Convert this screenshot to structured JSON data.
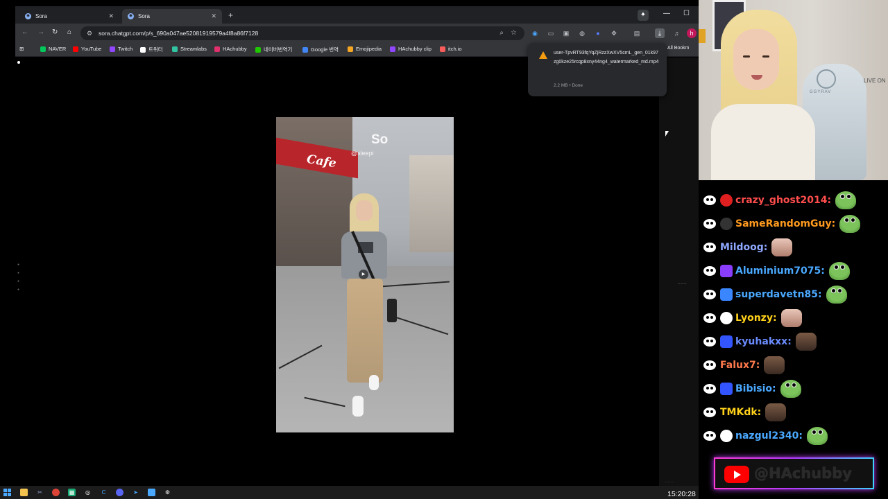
{
  "browser": {
    "tabs": [
      {
        "label": "Sora",
        "active": false
      },
      {
        "label": "Sora",
        "active": true
      }
    ],
    "new_tab_icon": "+",
    "address": "sora.chatgpt.com/p/s_690a047ae52081919579a4f8a86f7128",
    "bookmarks": [
      {
        "label": "NAVER",
        "color": "#03c75a"
      },
      {
        "label": "YouTube",
        "color": "#ff0000"
      },
      {
        "label": "Twitch",
        "color": "#9146ff"
      },
      {
        "label": "트위터",
        "color": "#ffffff"
      },
      {
        "label": "Streamlabs",
        "color": "#31c3a2"
      },
      {
        "label": "HAchubby",
        "color": "#e1306c"
      },
      {
        "label": "네이버번역기",
        "color": "#1ec800"
      },
      {
        "label": "Google 번역",
        "color": "#4285f4"
      },
      {
        "label": "Emojipedia",
        "color": "#f5a623"
      },
      {
        "label": "HAchubby clip",
        "color": "#9146ff"
      },
      {
        "label": "itch.io",
        "color": "#fa5c5c"
      }
    ],
    "all_bookmarks": "All Bookm",
    "download": {
      "filename": "user-TpvRT93fqYqZjRzzXwXV5cmL_gen_01k97zg0kze25rcqp8xny44ng4_watermarked_md.mp4",
      "status": "2.2 MB • Done"
    }
  },
  "video": {
    "watermark": "So",
    "handle": "@sleepi",
    "sign": "Cafe"
  },
  "taskbar": {
    "clock": "15:20:28"
  },
  "webcam": {
    "chair_text": "GGYRAV",
    "live_sign": "LIVE ON"
  },
  "chat": {
    "messages": [
      {
        "user": "crazy_ghost2014:",
        "color": "#ff4d4d",
        "badge": "#e02020",
        "emote": "pepe"
      },
      {
        "user": "SameRandomGuy:",
        "color": "#ff9a1f",
        "badge": "#222222",
        "emote": "pepe"
      },
      {
        "user": "Mildoog:",
        "color": "#8fa8ff",
        "badge": "",
        "emote": "photo"
      },
      {
        "user": "Aluminium7075:",
        "color": "#4aa8ff",
        "badge": "#8a3cff",
        "emote": "pepe"
      },
      {
        "user": "superdavetn85:",
        "color": "#4aa8ff",
        "badge": "#3a86ff",
        "emote": "pepe"
      },
      {
        "user": "Lyonzy:",
        "color": "#ffd11a",
        "badge": "#ffffff",
        "emote": "photo"
      },
      {
        "user": "kyuhakxx:",
        "color": "#6a8cff",
        "badge": "#3355ff",
        "emote": "person"
      },
      {
        "user": "Falux7:",
        "color": "#ff7a4d",
        "badge": "",
        "emote": "person"
      },
      {
        "user": "Bibisio:",
        "color": "#4aa8ff",
        "badge": "#3355ff",
        "emote": "pepe"
      },
      {
        "user": "TMKdk:",
        "color": "#ffd11a",
        "badge": "",
        "emote": "person"
      },
      {
        "user": "nazgul2340:",
        "color": "#4aa8ff",
        "badge": "#ffffff",
        "emote": "pepe"
      }
    ]
  },
  "overlay": {
    "youtube_handle": "@HAchubby"
  }
}
